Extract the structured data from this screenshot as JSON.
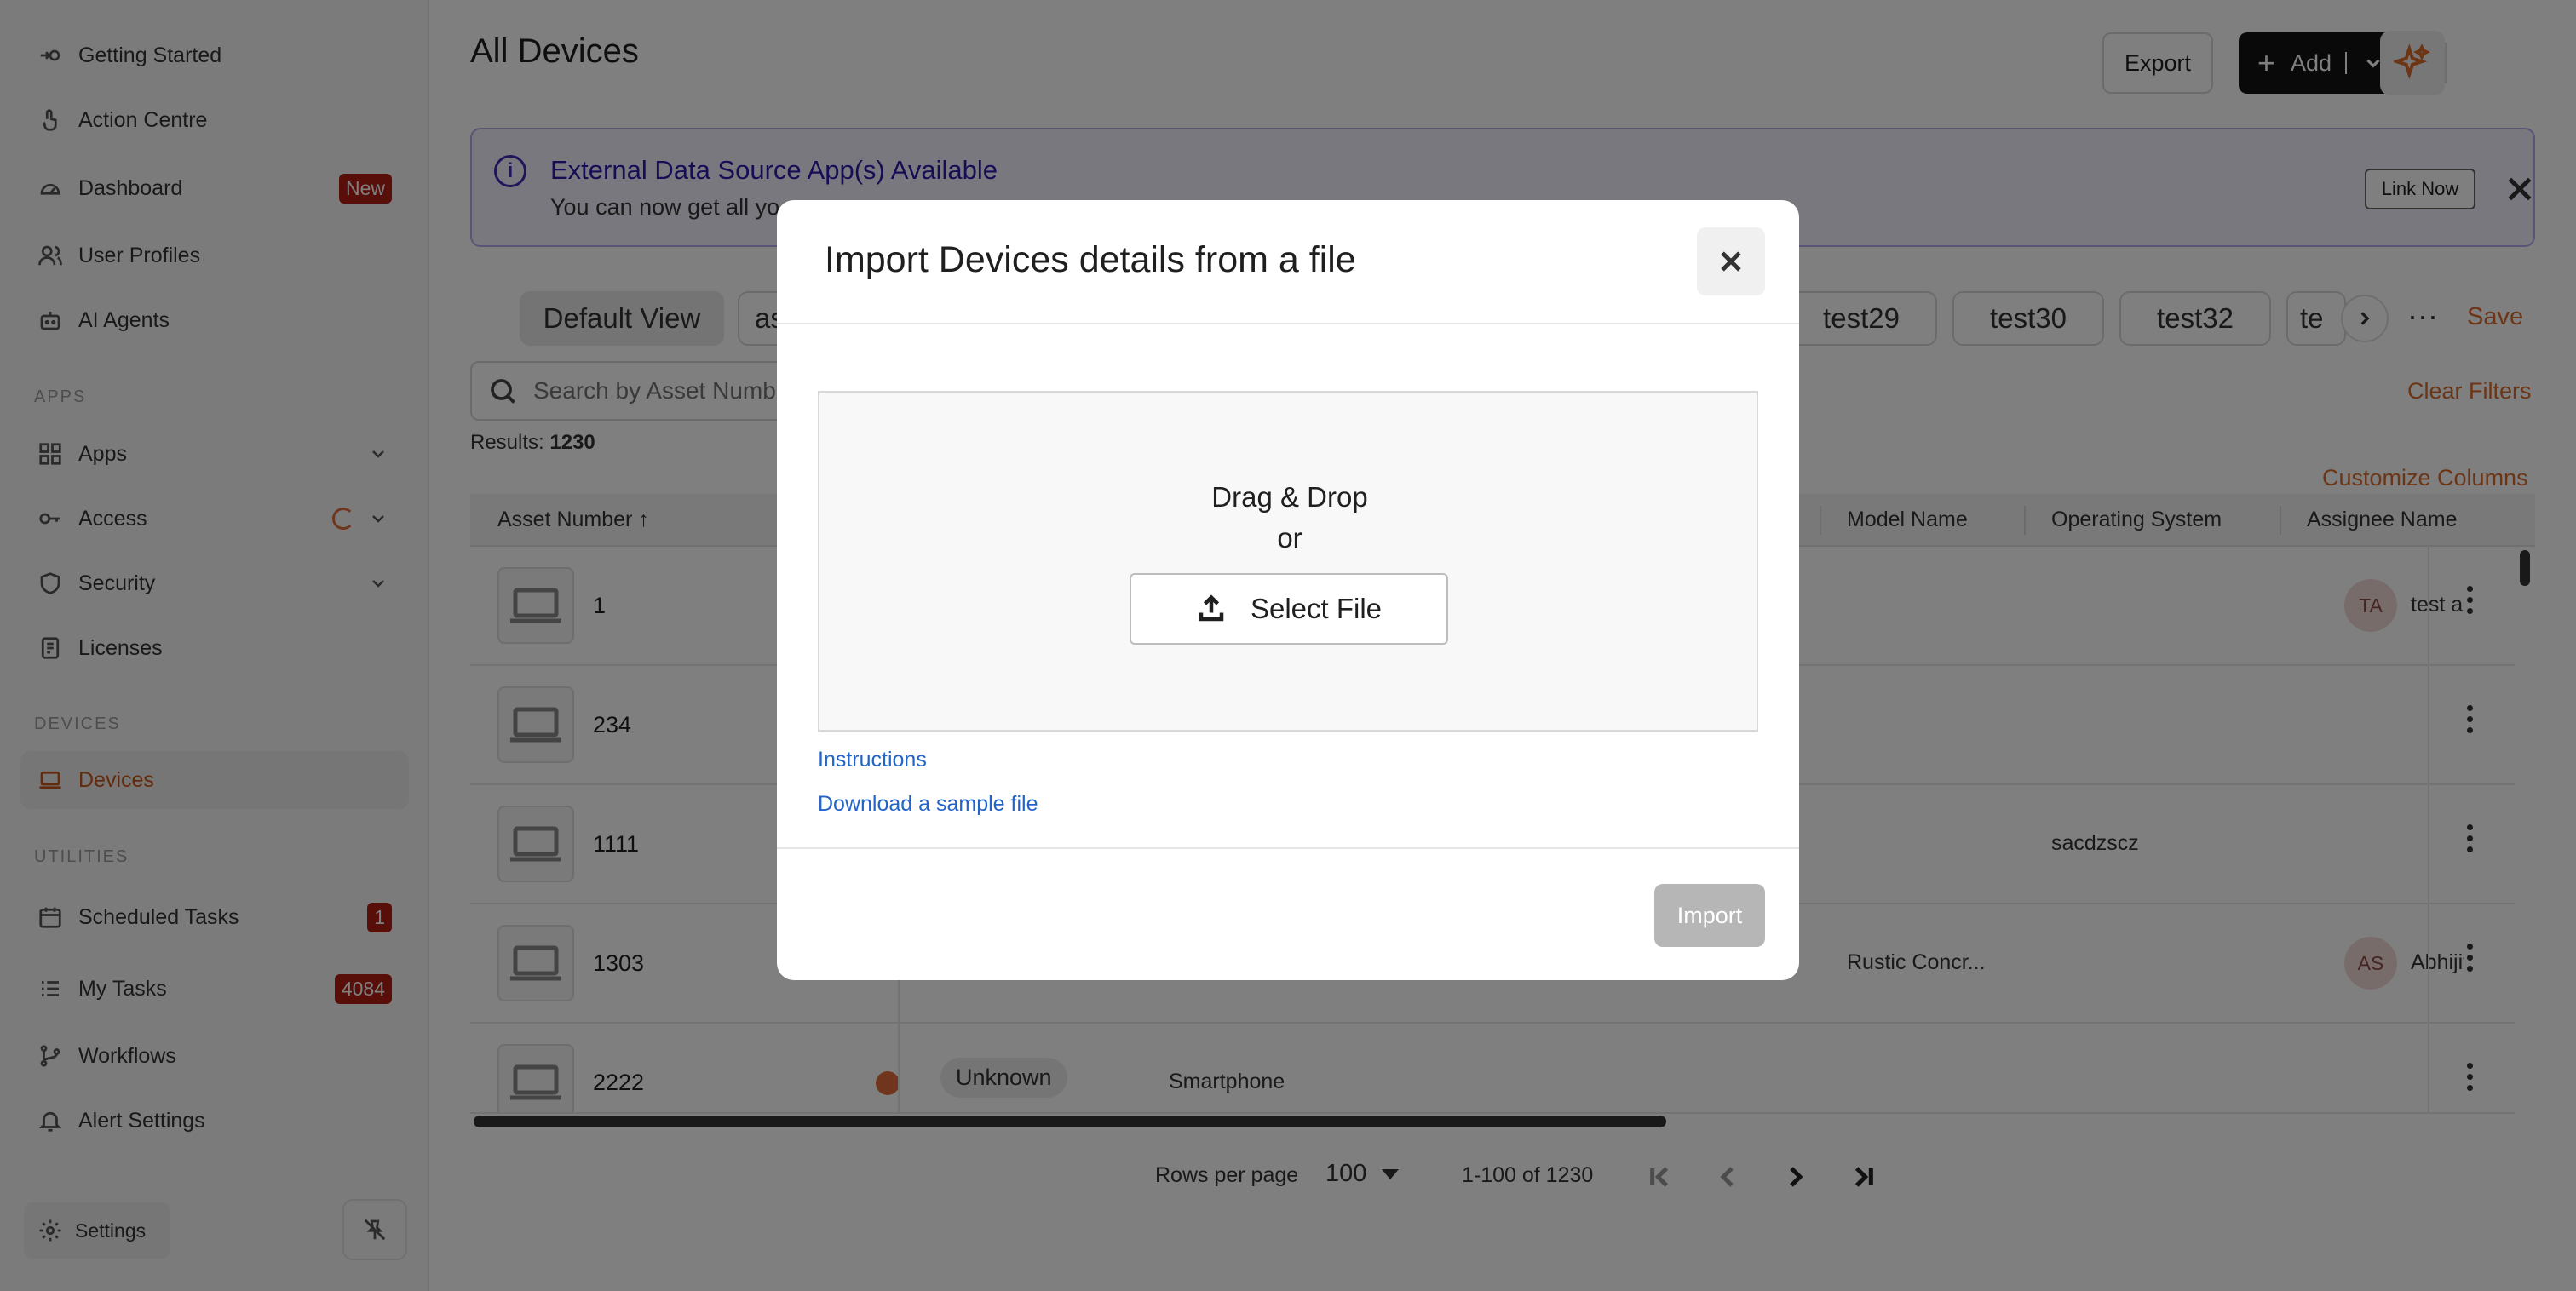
{
  "sidebar": {
    "items": [
      {
        "label": "Getting Started",
        "icon": "getting-started-icon"
      },
      {
        "label": "Action Centre",
        "icon": "hand-pointer-icon"
      },
      {
        "label": "Dashboard",
        "icon": "dashboard-icon",
        "badge": "New"
      },
      {
        "label": "User Profiles",
        "icon": "users-icon"
      },
      {
        "label": "AI Agents",
        "icon": "robot-icon"
      }
    ],
    "apps_section": "APPS",
    "apps_items": [
      {
        "label": "Apps",
        "icon": "grid-icon"
      },
      {
        "label": "Access",
        "icon": "key-icon"
      },
      {
        "label": "Security",
        "icon": "shield-icon"
      },
      {
        "label": "Licenses",
        "icon": "license-icon"
      }
    ],
    "devices_section": "DEVICES",
    "devices_items": [
      {
        "label": "Devices",
        "icon": "laptop-icon"
      }
    ],
    "utilities_section": "UTILITIES",
    "utilities_items": [
      {
        "label": "Scheduled Tasks",
        "icon": "calendar-icon",
        "badge": "1"
      },
      {
        "label": "My Tasks",
        "icon": "list-icon",
        "badge": "4084"
      },
      {
        "label": "Workflows",
        "icon": "workflow-icon"
      },
      {
        "label": "Alert Settings",
        "icon": "bell-icon"
      }
    ],
    "settings_label": "Settings"
  },
  "header": {
    "title": "All Devices",
    "export_label": "Export",
    "add_label": "Add"
  },
  "banner": {
    "title": "External Data Source App(s) Available",
    "text": "You can now get all yo",
    "link_label": "Link Now"
  },
  "tabs": [
    "Default View",
    "as",
    "test29",
    "test30",
    "test32",
    "te"
  ],
  "save_label": "Save",
  "search": {
    "placeholder": "Search by Asset Number"
  },
  "clear_filters": "Clear Filters",
  "results": {
    "label": "Results:",
    "count": "1230"
  },
  "customize_columns": "Customize Columns",
  "table": {
    "columns": [
      "Asset Number",
      "Model Name",
      "Operating System",
      "Assignee Name"
    ],
    "rows": [
      {
        "asset": "1",
        "model": "",
        "os": "",
        "assignee_initials": "TA",
        "assignee": "test ar"
      },
      {
        "asset": "234",
        "model": "",
        "os": "",
        "assignee_initials": "",
        "assignee": ""
      },
      {
        "asset": "1111",
        "model": "",
        "os": "sacdzscz",
        "assignee_initials": "",
        "assignee": ""
      },
      {
        "asset": "1303",
        "model": "Rustic Concr...",
        "os": "",
        "assignee_initials": "AS",
        "assignee": "Abhijit"
      },
      {
        "asset": "2222",
        "status": "Unknown",
        "type": "Smartphone",
        "model": "",
        "os": "",
        "assignee_initials": "",
        "assignee": ""
      }
    ]
  },
  "pagination": {
    "rows_per_page_label": "Rows per page",
    "rows_per_page": "100",
    "range": "1-100 of 1230"
  },
  "modal": {
    "title": "Import Devices details from a file",
    "drag_drop": "Drag & Drop",
    "or": "or",
    "select_file": "Select File",
    "instructions": "Instructions",
    "download_sample": "Download a sample file",
    "import_label": "Import"
  }
}
